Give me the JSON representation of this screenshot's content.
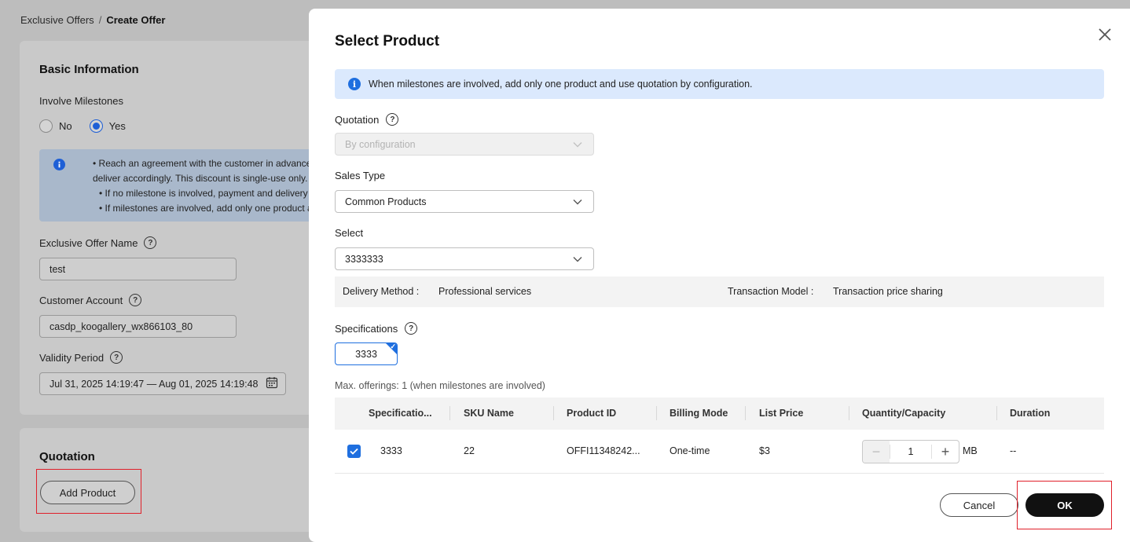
{
  "breadcrumb": {
    "parent": "Exclusive Offers",
    "separator": "/",
    "current": "Create Offer"
  },
  "basic_info": {
    "title": "Basic Information",
    "milestones_label": "Involve Milestones",
    "radio_no": "No",
    "radio_yes": "Yes",
    "selected": "Yes",
    "notice_lines": [
      "• Reach an agreement with the customer in advance i",
      "deliver accordingly. This discount is single-use only.",
      "• If no milestone is involved, payment and delivery mu",
      "• If milestones are involved, add only one product and"
    ],
    "offer_name_label": "Exclusive Offer Name",
    "offer_name_value": "test",
    "customer_label": "Customer Account",
    "customer_value": "casdp_koogallery_wx866103_80",
    "validity_label": "Validity Period",
    "validity_value": "Jul 31, 2025 14:19:47 — Aug 01, 2025 14:19:48"
  },
  "quotation_section": {
    "title": "Quotation",
    "add_product": "Add Product"
  },
  "modal": {
    "title": "Select Product",
    "banner": "When milestones are involved, add only one product and use quotation by configuration.",
    "quotation_label": "Quotation",
    "quotation_value": "By configuration",
    "sales_type_label": "Sales Type",
    "sales_type_value": "Common Products",
    "select_label": "Select",
    "select_value": "3333333",
    "delivery_method_label": "Delivery Method :",
    "delivery_method_value": "Professional services",
    "transaction_model_label": "Transaction Model :",
    "transaction_model_value": "Transaction price sharing",
    "specifications_label": "Specifications",
    "spec_option": "3333",
    "max_note": "Max. offerings: 1 (when milestones are involved)",
    "table": {
      "headers": [
        "Specificatio...",
        "SKU Name",
        "Product ID",
        "Billing Mode",
        "List Price",
        "Quantity/Capacity",
        "Duration"
      ],
      "rows": [
        {
          "spec": "3333",
          "sku": "22",
          "product_id": "OFFI11348242...",
          "billing": "One-time",
          "price": "$3",
          "quantity": "1",
          "unit": "MB",
          "duration": "--"
        }
      ]
    },
    "cancel": "Cancel",
    "ok": "OK"
  }
}
